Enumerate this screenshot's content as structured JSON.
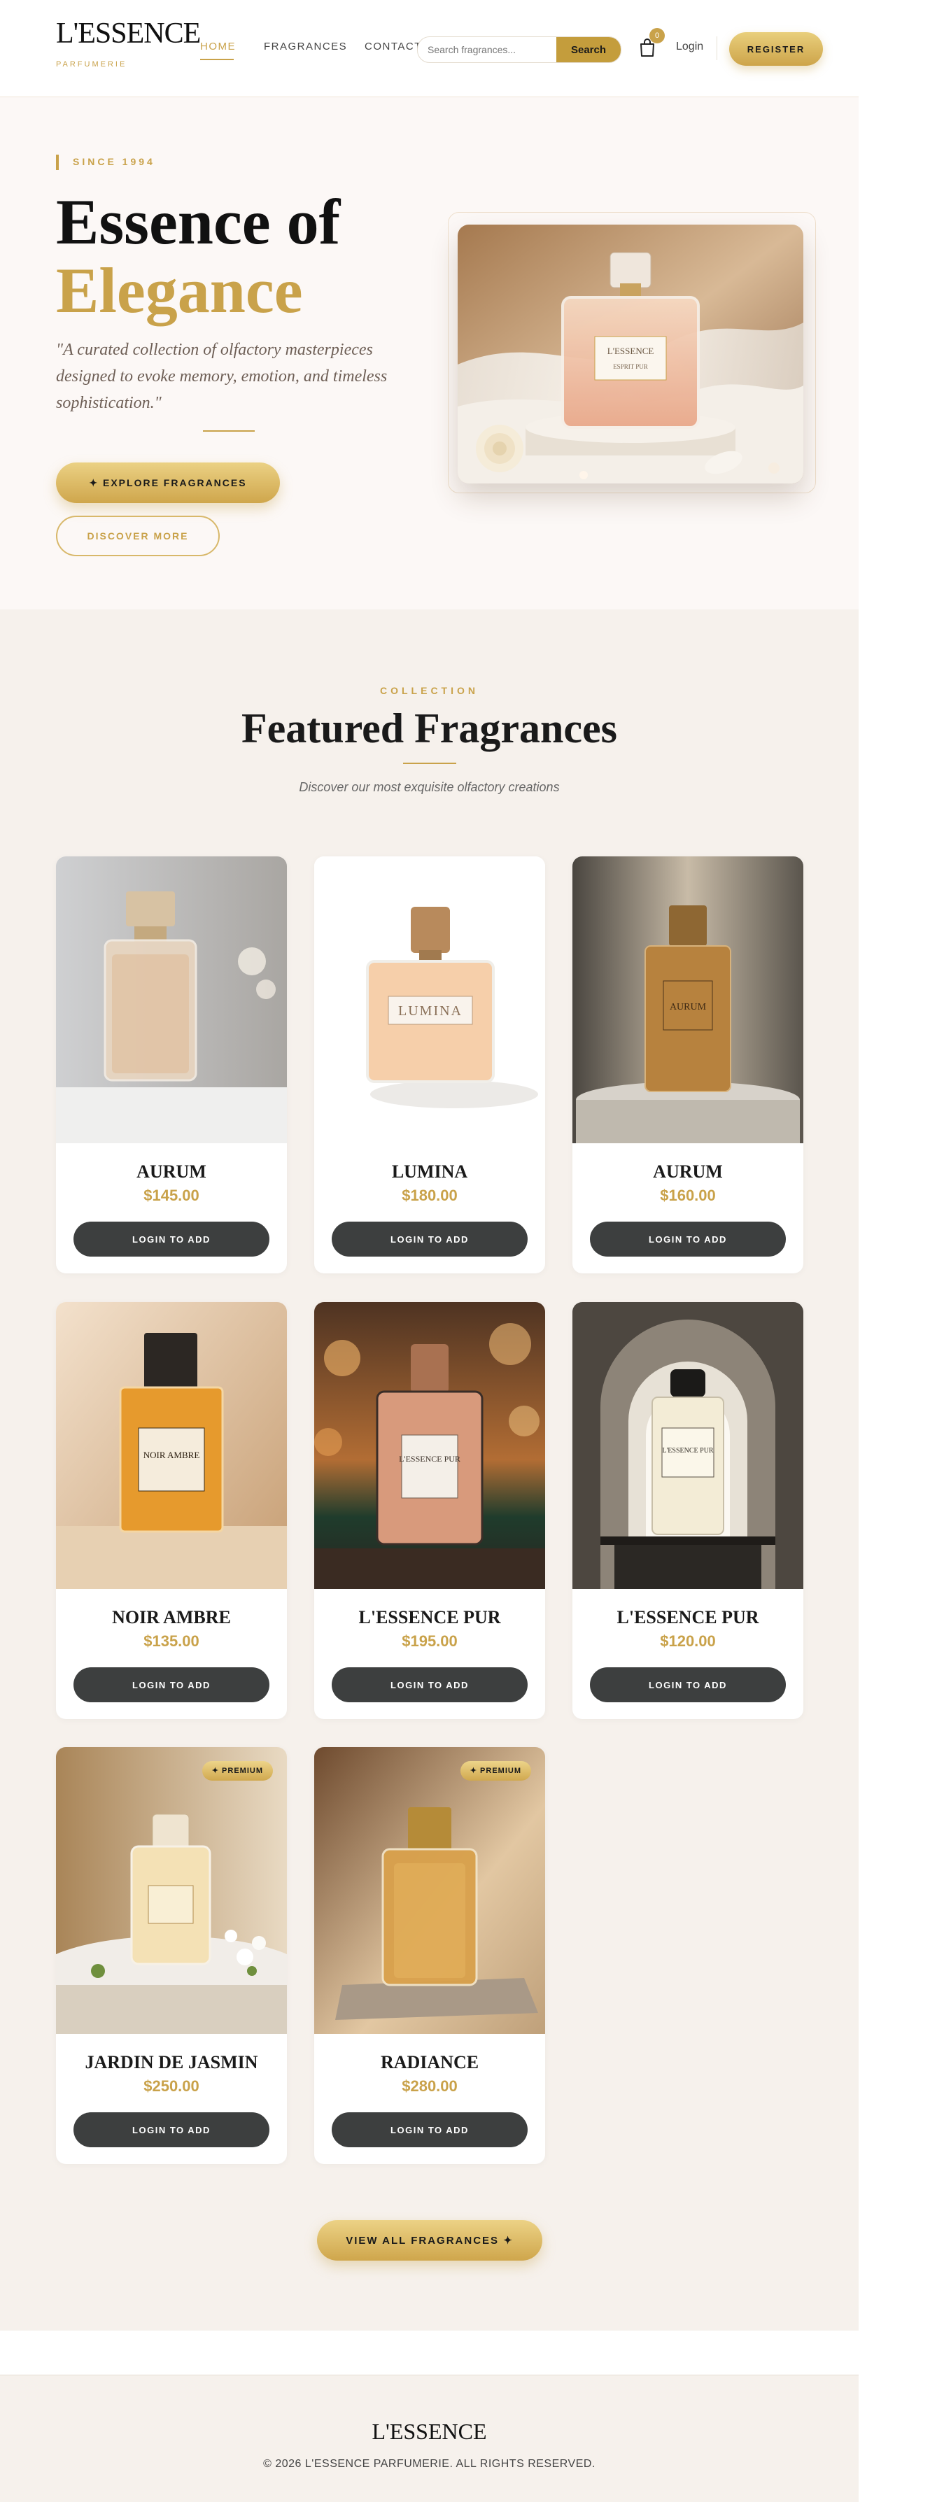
{
  "brand": {
    "name": "L'ESSENCE",
    "tagline": "PARFUMERIE"
  },
  "nav": {
    "items": [
      {
        "label": "HOME",
        "active": true
      },
      {
        "label": "FRAGRANCES",
        "active": false
      },
      {
        "label": "CONTACT",
        "active": false
      }
    ]
  },
  "search": {
    "placeholder": "Search fragrances...",
    "button_label": "Search"
  },
  "cart": {
    "count": "0"
  },
  "auth": {
    "login_label": "Login",
    "register_label": "REGISTER"
  },
  "hero": {
    "since": "SINCE 1994",
    "title_line1": "Essence of",
    "title_line2": "Elegance",
    "tagline": "\"A curated collection of olfactory masterpieces designed to evoke memory, emotion, and timeless sophistication.\"",
    "primary_button": "✦ EXPLORE FRAGRANCES",
    "secondary_button": "DISCOVER MORE",
    "bottle_label": {
      "line1": "L'ESSENCE",
      "line2": "ESPRIT PUR"
    }
  },
  "featured": {
    "label": "COLLECTION",
    "title": "Featured Fragrances",
    "subtitle": "Discover our most exquisite olfactory creations",
    "button_label": "LOGIN TO ADD",
    "premium_label": "✦ PREMIUM",
    "products": [
      {
        "name": "AURUM",
        "price": "$145.00",
        "premium": false
      },
      {
        "name": "LUMINA",
        "price": "$180.00",
        "premium": false,
        "bottle_text": "LUMINA"
      },
      {
        "name": "AURUM",
        "price": "$160.00",
        "premium": false,
        "bottle_text": "AURUM"
      },
      {
        "name": "NOIR AMBRE",
        "price": "$135.00",
        "premium": false,
        "bottle_text": "NOIR AMBRE"
      },
      {
        "name": "L'ESSENCE PUR",
        "price": "$195.00",
        "premium": false,
        "bottle_text": "L'ESSENCE PUR"
      },
      {
        "name": "L'ESSENCE PUR",
        "price": "$120.00",
        "premium": false,
        "bottle_text": "L'ESSENCE PUR"
      },
      {
        "name": "JARDIN DE JASMIN",
        "price": "$250.00",
        "premium": true
      },
      {
        "name": "RADIANCE",
        "price": "$280.00",
        "premium": true
      }
    ],
    "view_all": "VIEW ALL FRAGRANCES ✦"
  },
  "footer": {
    "logo": "L'ESSENCE",
    "copyright": "© 2026 L'ESSENCE PARFUMERIE. ALL RIGHTS RESERVED."
  },
  "colors": {
    "gold": "#c9a24a",
    "dark_button": "#3d3f3f",
    "hero_bg": "#fcf8f6",
    "section_bg": "#f6f1ec"
  }
}
